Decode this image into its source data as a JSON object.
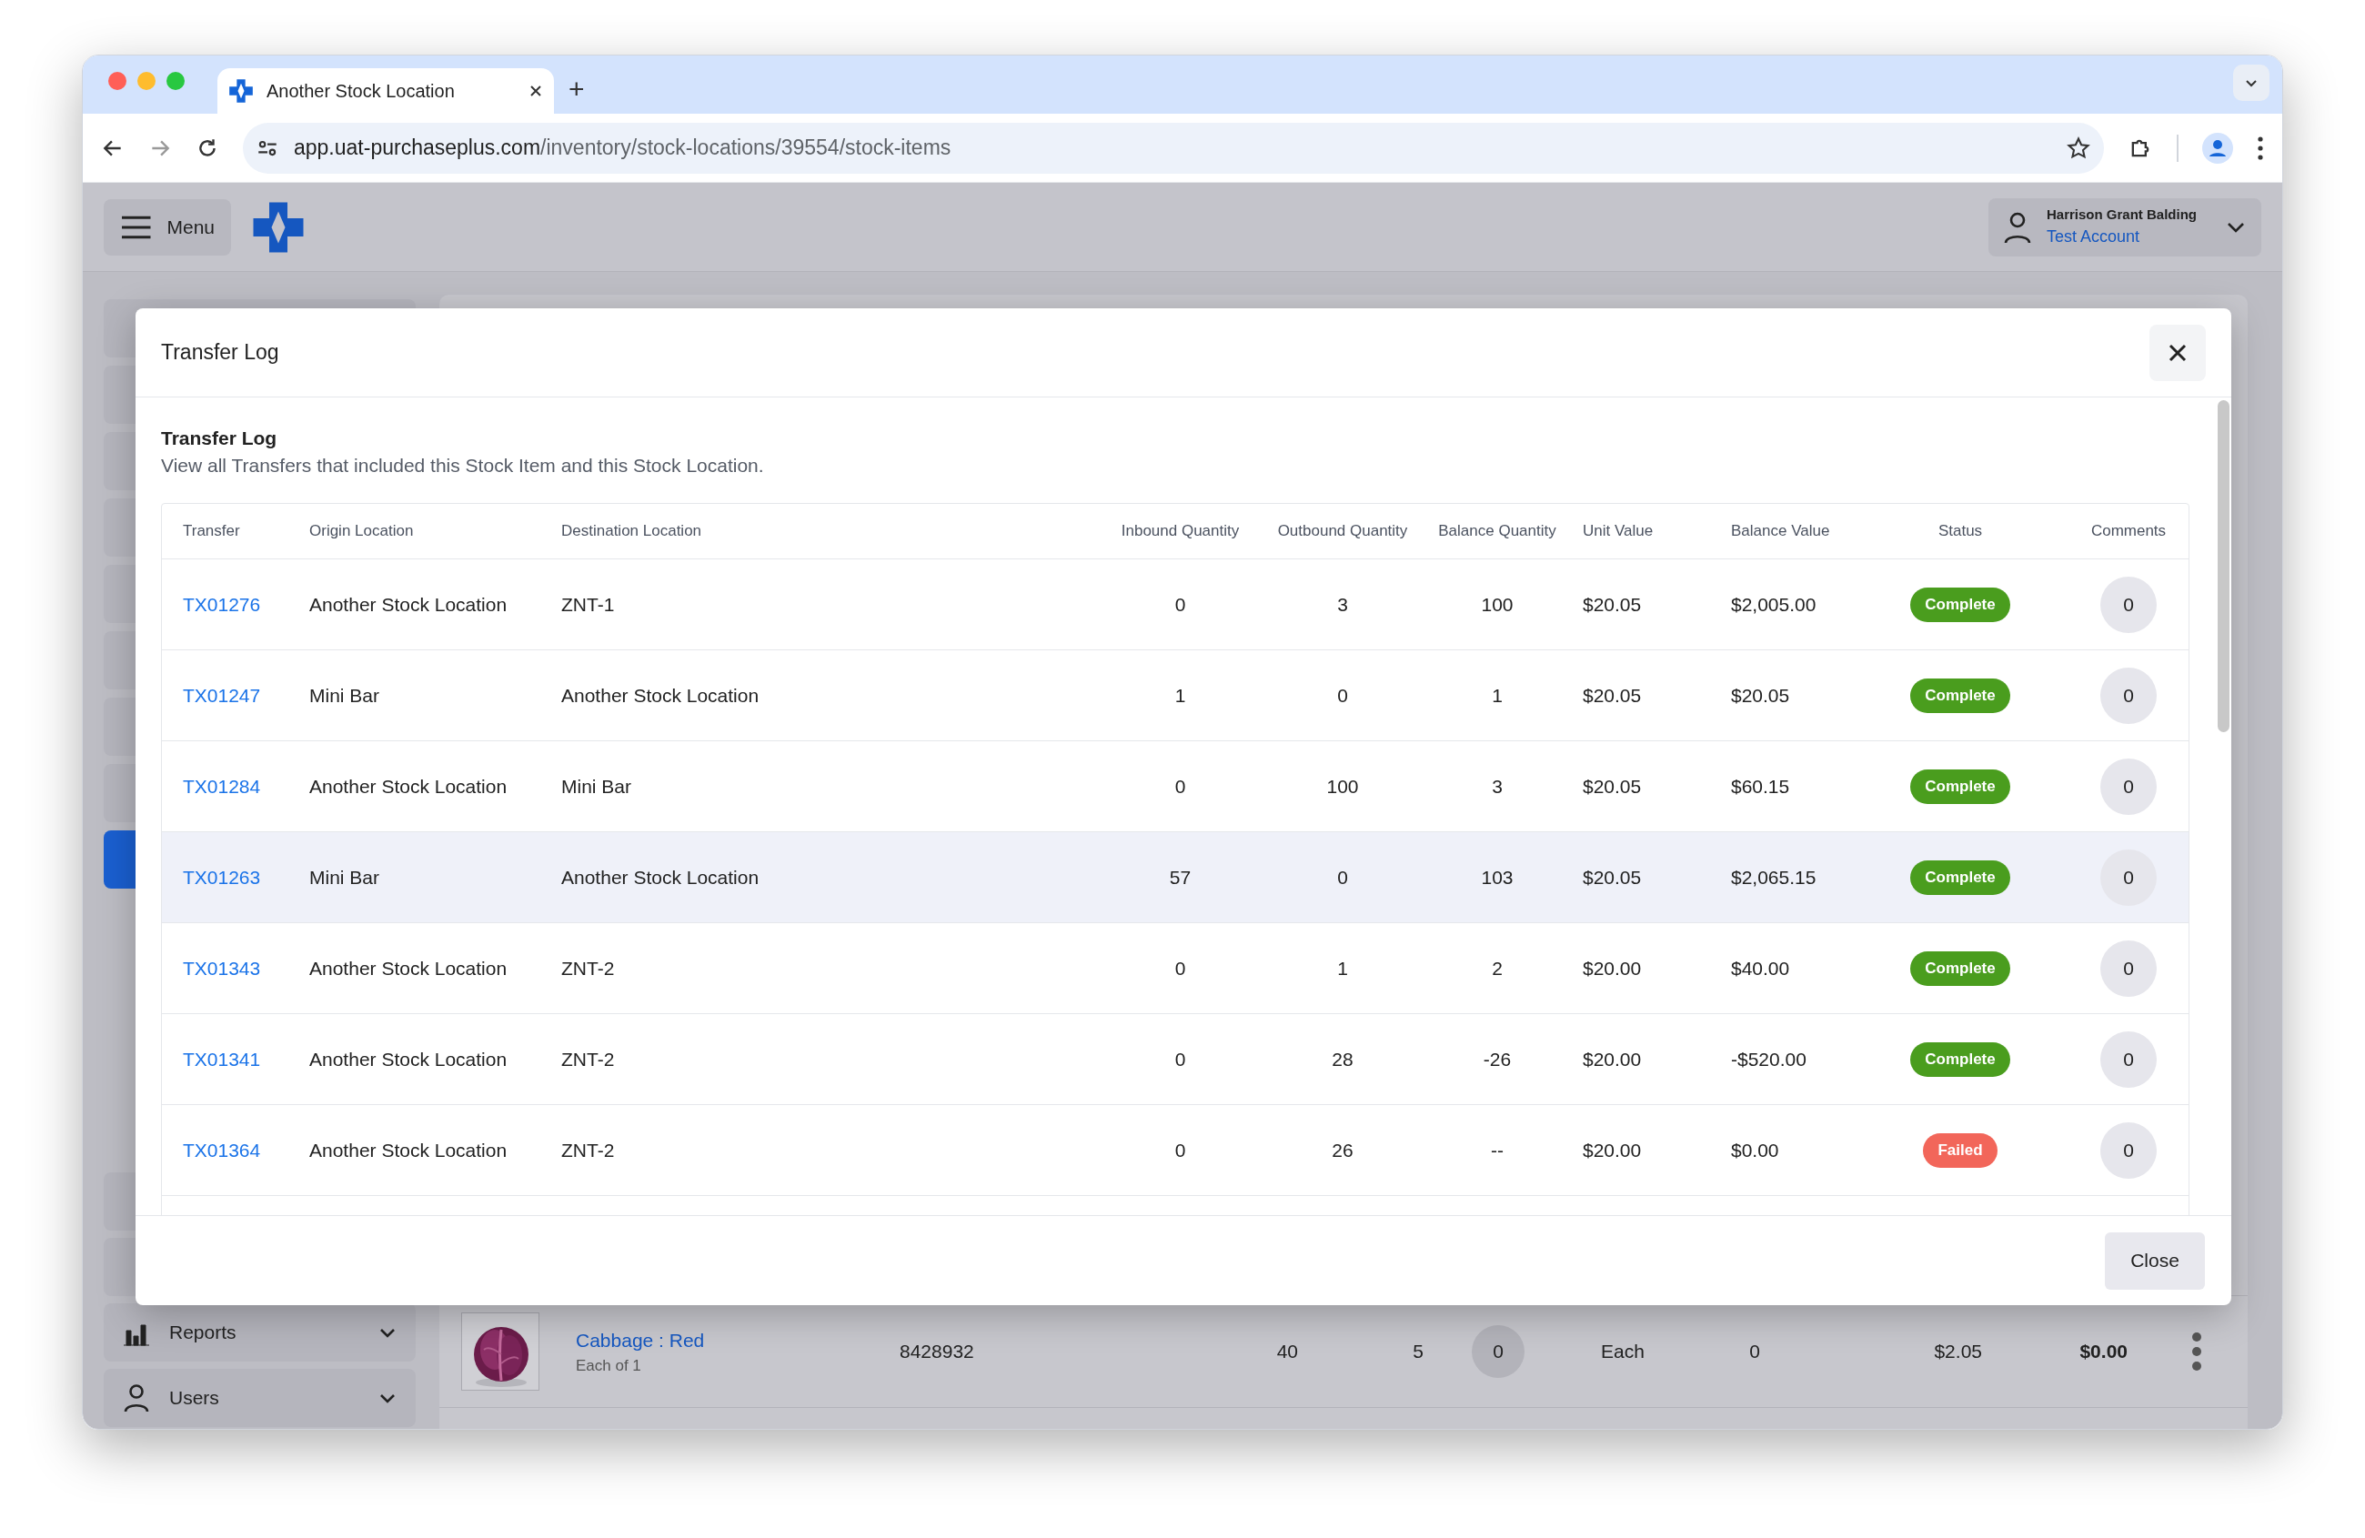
{
  "browser": {
    "tab_title": "Another Stock Location",
    "new_tab": "+",
    "url_host": "app.uat-purchaseplus.com",
    "url_path": "/inventory/stock-locations/39554/stock-items"
  },
  "app_header": {
    "menu_label": "Menu",
    "user_name": "Harrison Grant Balding",
    "account": "Test Account"
  },
  "sidebar": {
    "items": [
      {
        "selected": false
      },
      {
        "selected": false
      },
      {
        "selected": false
      },
      {
        "selected": false
      },
      {
        "selected": false
      },
      {
        "selected": false
      },
      {
        "selected": false
      },
      {
        "selected": false
      },
      {
        "selected": true
      }
    ],
    "bottom_items": [
      {
        "selected": false
      },
      {
        "selected": false
      },
      {
        "label": "Reports",
        "selected": false
      },
      {
        "label": "Users",
        "selected": false
      }
    ]
  },
  "background_row": {
    "name": "Cabbage : Red",
    "unit": "Each of 1",
    "code": "8428932",
    "column_3": "40",
    "column_4": "5",
    "column_5": "0",
    "column_6": "Each",
    "column_7": "0",
    "column_8": "$2.05",
    "column_9": "$0.00"
  },
  "modal": {
    "title": "Transfer Log",
    "section_title": "Transfer Log",
    "section_description": "View all Transfers that included this Stock Item and this Stock Location.",
    "table": {
      "columns": [
        "Transfer",
        "Origin Location",
        "Destination Location",
        "Inbound Quantity",
        "Outbound Quantity",
        "Balance Quantity",
        "Unit Value",
        "Balance Value",
        "Status",
        "Comments"
      ],
      "rows": [
        {
          "transfer": "TX01276",
          "origin": "Another Stock Location",
          "destination": "ZNT-1",
          "inbound": "0",
          "outbound": "3",
          "balance_qty": "100",
          "unit_value": "$20.05",
          "balance_value": "$2,005.00",
          "status": {
            "label": "Complete",
            "color": "#4a9d1e"
          },
          "comments": "0",
          "highlighted": false
        },
        {
          "transfer": "TX01247",
          "origin": "Mini Bar",
          "destination": "Another Stock Location",
          "inbound": "1",
          "outbound": "0",
          "balance_qty": "1",
          "unit_value": "$20.05",
          "balance_value": "$20.05",
          "status": {
            "label": "Complete",
            "color": "#4a9d1e"
          },
          "comments": "0",
          "highlighted": false
        },
        {
          "transfer": "TX01284",
          "origin": "Another Stock Location",
          "destination": "Mini Bar",
          "inbound": "0",
          "outbound": "100",
          "balance_qty": "3",
          "unit_value": "$20.05",
          "balance_value": "$60.15",
          "status": {
            "label": "Complete",
            "color": "#4a9d1e"
          },
          "comments": "0",
          "highlighted": false
        },
        {
          "transfer": "TX01263",
          "origin": "Mini Bar",
          "destination": "Another Stock Location",
          "inbound": "57",
          "outbound": "0",
          "balance_qty": "103",
          "unit_value": "$20.05",
          "balance_value": "$2,065.15",
          "status": {
            "label": "Complete",
            "color": "#4a9d1e"
          },
          "comments": "0",
          "highlighted": true
        },
        {
          "transfer": "TX01343",
          "origin": "Another Stock Location",
          "destination": "ZNT-2",
          "inbound": "0",
          "outbound": "1",
          "balance_qty": "2",
          "unit_value": "$20.00",
          "balance_value": "$40.00",
          "status": {
            "label": "Complete",
            "color": "#4a9d1e"
          },
          "comments": "0",
          "highlighted": false
        },
        {
          "transfer": "TX01341",
          "origin": "Another Stock Location",
          "destination": "ZNT-2",
          "inbound": "0",
          "outbound": "28",
          "balance_qty": "-26",
          "unit_value": "$20.00",
          "balance_value": "-$520.00",
          "status": {
            "label": "Complete",
            "color": "#4a9d1e"
          },
          "comments": "0",
          "highlighted": false
        },
        {
          "transfer": "TX01364",
          "origin": "Another Stock Location",
          "destination": "ZNT-2",
          "inbound": "0",
          "outbound": "26",
          "balance_qty": "--",
          "unit_value": "$20.00",
          "balance_value": "$0.00",
          "status": {
            "label": "Failed",
            "color": "#f2665a"
          },
          "comments": "0",
          "highlighted": false
        }
      ]
    },
    "close_button": "Close"
  }
}
